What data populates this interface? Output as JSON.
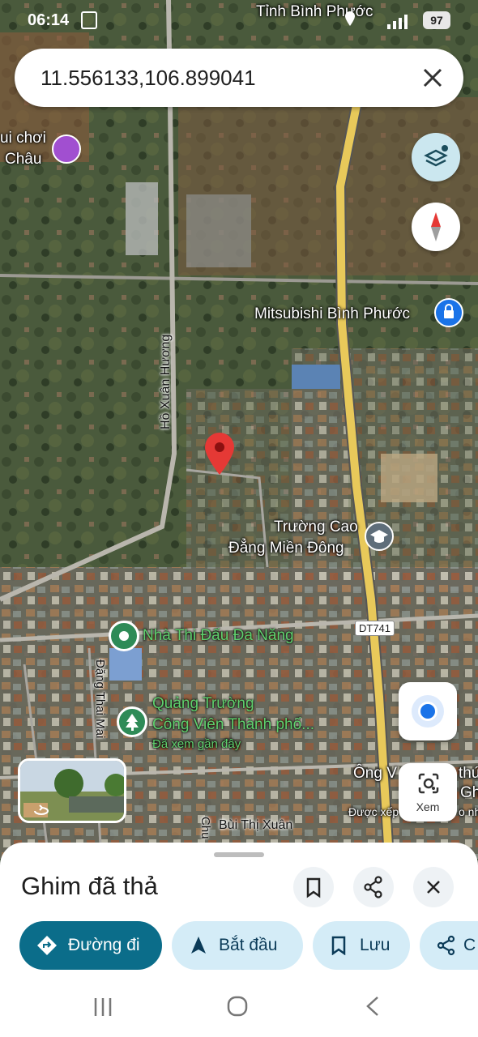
{
  "status_bar": {
    "time": "06:14",
    "battery": "97",
    "top_label": "Tỉnh Bình Phước"
  },
  "search": {
    "query": "11.556133,106.899041"
  },
  "map_labels": {
    "place_left_1": "ui chơi",
    "place_left_2": "Châu",
    "mitsubishi": "Mitsubishi Bình Phước",
    "road_ho_xuan_huong": "Hồ Xuân Hương",
    "school_1": "Trường Cao",
    "school_2": "Đẳng Miền Đông",
    "road_code": "DT741",
    "gym": "Nhà Thi Đấu Đa Năng",
    "road_dang_thai_mai": "Đặng Thai Mai",
    "square_1": "Quảng Trường",
    "square_2": "Công Viên Thành phố...",
    "square_note": "Đã xem gần đây",
    "ong_1": "Ông V",
    "ong_2": "thức",
    "ong_3": "Gh",
    "ong_4": "Được xếp",
    "ong_5": "o nh",
    "road_bui_thi_xuan": "Bùi Thị Xuân",
    "road_chu": "Chu",
    "lens_label": "Xem"
  },
  "sheet": {
    "title": "Ghim đã thả",
    "chips": [
      {
        "label": "Đường đi"
      },
      {
        "label": "Bắt đầu"
      },
      {
        "label": "Lưu"
      },
      {
        "label": "C"
      }
    ]
  },
  "icons": {
    "layers": "layers-icon",
    "compass": "compass-icon",
    "pin": "dropped-pin-icon",
    "my_location": "my-location-icon",
    "lens": "google-lens-icon",
    "bookmark": "bookmark-icon",
    "share": "share-icon",
    "close": "close-icon"
  },
  "colors": {
    "primary_chip": "#0b6d8a",
    "chip": "#d4ecf7",
    "pin": "#e53935",
    "road": "#e8c95a"
  }
}
